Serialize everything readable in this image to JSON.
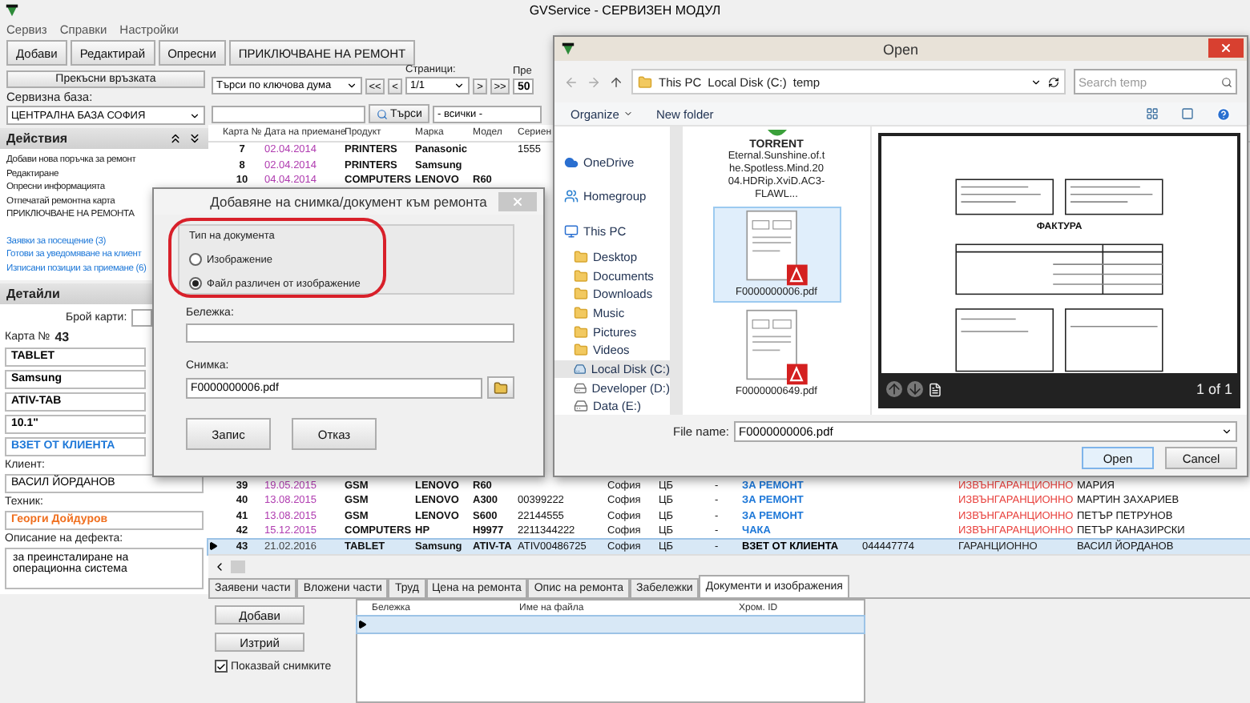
{
  "window": {
    "title": "GVService - СЕРВИЗЕН МОДУЛ"
  },
  "menu": [
    "Сервиз",
    "Справки",
    "Настройки"
  ],
  "toolbar": [
    "Добави",
    "Редактирай",
    "Опресни",
    "ПРИКЛЮЧВАНЕ НА РЕМОНТ"
  ],
  "connection": {
    "disconnect_button": "Прекъсни връзката",
    "base_label": "Сервизна база:",
    "base_value": "ЦЕНТРАЛНА БАЗА СОФИЯ"
  },
  "search": {
    "mode": "Търси по ключова дума",
    "first": "<<",
    "prev": "<",
    "pages_label": "Страници:",
    "page": "1/1",
    "next": ">",
    "last": ">>",
    "per_page_label": "Пре",
    "per_page": "50",
    "search_button": "Търси",
    "filter": "- всички -"
  },
  "actions": {
    "title": "Действия",
    "items": [
      {
        "text": "Добави нова поръчка за ремонт",
        "kind": "command"
      },
      {
        "text": "Редактиране",
        "kind": "command"
      },
      {
        "text": "Опресни информацията",
        "kind": "command"
      },
      {
        "text": "Отпечатай ремонтна карта",
        "kind": "command"
      },
      {
        "text": "ПРИКЛЮЧВАНЕ НА РЕМОНТА",
        "kind": "command"
      },
      {
        "text": "Заявки за посещение (3)",
        "kind": "link"
      },
      {
        "text": "Готови за уведомяване на клиент",
        "kind": "link"
      },
      {
        "text": "Изписани позиции за приемане (6)",
        "kind": "link"
      }
    ]
  },
  "details": {
    "title": "Детайли",
    "count_label": "Брой карти:",
    "card_label": "Карта №",
    "card_no": "43",
    "fields": [
      {
        "text": "TABLET",
        "color": "#000000"
      },
      {
        "text": "Samsung",
        "color": "#000000"
      },
      {
        "text": "ATIV-TAB",
        "color": "#000000"
      },
      {
        "text": "10.1\"",
        "color": "#000000"
      },
      {
        "text": "ВЗЕТ ОТ КЛИЕНТА",
        "color": "#1e78d8"
      }
    ],
    "client_label": "Клиент:",
    "client": "ВАСИЛ ЙОРДАНОВ",
    "tech_label": "Техник:",
    "tech": "Георги Дойдуров",
    "defect_label": "Описание на дефекта:",
    "defect": "за преинсталиране на операционна система"
  },
  "table": {
    "columns": [
      "Карта №",
      "Дата на приемане",
      "Продукт",
      "Марка",
      "Модел",
      "Сериен"
    ],
    "rows": [
      {
        "selected": false,
        "cells": [
          "7",
          {
            "text": "02.04.2014",
            "color": "#b03cb0"
          },
          "PRINTERS",
          "Panasonic",
          null,
          "1555"
        ]
      },
      {
        "selected": false,
        "cells": [
          "8",
          {
            "text": "02.04.2014",
            "color": "#b03cb0"
          },
          "PRINTERS",
          "Samsung",
          null,
          null
        ]
      },
      {
        "selected": false,
        "cells": [
          "10",
          {
            "text": "04.04.2014",
            "color": "#b03cb0"
          },
          "COMPUTERS",
          "LENOVO",
          "R60",
          null
        ]
      },
      {
        "selected": false,
        "cells": [
          "39",
          {
            "text": "19.05.2015",
            "color": "#b03cb0"
          },
          "GSM",
          "LENOVO",
          "R60",
          null,
          "София",
          "ЦБ",
          "-",
          {
            "text": "ЗА РЕМОНТ",
            "color": "#1e78d8"
          },
          null,
          {
            "text": "ИЗВЪНГАРАНЦИОННО",
            "color": "#e8403c"
          },
          "МАРИЯ"
        ]
      },
      {
        "selected": false,
        "cells": [
          "40",
          {
            "text": "13.08.2015",
            "color": "#b03cb0"
          },
          "GSM",
          "LENOVO",
          "A300",
          "00399222",
          "София",
          "ЦБ",
          "-",
          {
            "text": "ЗА РЕМОНТ",
            "color": "#1e78d8"
          },
          null,
          {
            "text": "ИЗВЪНГАРАНЦИОННО",
            "color": "#e8403c"
          },
          "МАРТИН ЗАХАРИЕВ"
        ]
      },
      {
        "selected": false,
        "cells": [
          "41",
          {
            "text": "13.08.2015",
            "color": "#b03cb0"
          },
          "GSM",
          "LENOVO",
          "S600",
          "22144555",
          "София",
          "ЦБ",
          "-",
          {
            "text": "ЗА РЕМОНТ",
            "color": "#1e78d8"
          },
          null,
          {
            "text": "ИЗВЪНГАРАНЦИОННО",
            "color": "#e8403c"
          },
          "ПЕТЪР ПЕТРУНОВ"
        ]
      },
      {
        "selected": false,
        "cells": [
          "42",
          {
            "text": "15.12.2015",
            "color": "#b03cb0"
          },
          "COMPUTERS",
          "HP",
          "H9977",
          "2211344222",
          "София",
          "ЦБ",
          "-",
          {
            "text": "ЧАКА",
            "color": "#1e78d8"
          },
          null,
          {
            "text": "ИЗВЪНГАРАНЦИОННО",
            "color": "#e8403c"
          },
          "ПЕТЪР КАНАЗИРСКИ"
        ]
      },
      {
        "selected": true,
        "cells": [
          "43",
          {
            "text": "21.02.2016",
            "color": "#444444"
          },
          "TABLET",
          "Samsung",
          "ATIV-TA",
          "ATIV00486725",
          "София",
          "ЦБ",
          "-",
          {
            "text": "ВЗЕТ ОТ КЛИЕНТА",
            "color": "#000000"
          },
          "044447774",
          {
            "text": "ГАРАНЦИОННО",
            "color": "#222222"
          },
          "ВАСИЛ ЙОРДАНОВ"
        ]
      }
    ]
  },
  "bottom_tabs": [
    {
      "label": "Заявени части",
      "selected": false
    },
    {
      "label": "Вложени части",
      "selected": false
    },
    {
      "label": "Труд",
      "selected": false
    },
    {
      "label": "Цена на ремонта",
      "selected": false
    },
    {
      "label": "Опис на ремонта",
      "selected": false
    },
    {
      "label": "Забележки",
      "selected": false
    },
    {
      "label": "Документи и изображения",
      "selected": true
    }
  ],
  "documents": {
    "add_button": "Добави",
    "delete_button": "Изтрий",
    "show_images": {
      "label": "Показвай снимките",
      "checked": true
    },
    "columns": [
      "Бележка",
      "Име на файла",
      "Хром. ID"
    ]
  },
  "attach_dialog": {
    "title": "Добавяне на снимка/документ към ремонта",
    "type_group": "Тип на документа",
    "types": [
      {
        "label": "Изображение",
        "selected": false
      },
      {
        "label": "Файл различен от изображение",
        "selected": true
      }
    ],
    "note_label": "Бележка:",
    "image_label": "Снимка:",
    "image_value": "F0000000006.pdf",
    "buttons": [
      "Запис",
      "Отказ"
    ]
  },
  "open_dialog": {
    "title": "Open",
    "path": [
      "This PC",
      "Local Disk (C:)",
      "temp"
    ],
    "search_placeholder": "Search temp",
    "organize": "Organize",
    "new_folder": "New folder",
    "nav": [
      {
        "label": "OneDrive",
        "kind": "cloud",
        "selected": false
      },
      {
        "label": "Homegroup",
        "kind": "group",
        "selected": false
      },
      {
        "label": "This PC",
        "kind": "pc",
        "selected": false,
        "children": [
          {
            "label": "Desktop",
            "kind": "folder",
            "selected": false
          },
          {
            "label": "Documents",
            "kind": "folder",
            "selected": false
          },
          {
            "label": "Downloads",
            "kind": "folder",
            "selected": false
          },
          {
            "label": "Music",
            "kind": "folder",
            "selected": false
          },
          {
            "label": "Pictures",
            "kind": "folder",
            "selected": false
          },
          {
            "label": "Videos",
            "kind": "folder",
            "selected": false
          },
          {
            "label": "Local Disk (C:)",
            "kind": "disk",
            "selected": true
          },
          {
            "label": "Developer (D:)",
            "kind": "drive",
            "selected": false
          },
          {
            "label": "Data (E:)",
            "kind": "drive",
            "selected": false
          }
        ]
      }
    ],
    "files": [
      {
        "kind": "torrent",
        "badge": "TORRENT",
        "name": "Eternal.Sunshine.of.the.Spotless.Mind.2004.HDRip.XviD.AC3-FLAWL...",
        "selected": false
      },
      {
        "kind": "pdf",
        "name": "F0000000006.pdf",
        "selected": true
      },
      {
        "kind": "pdf",
        "name": "F0000000649.pdf",
        "selected": false
      }
    ],
    "preview": {
      "heading": "ФАКТУРА",
      "page": "1 of 1"
    },
    "file_name_label": "File name:",
    "file_name": "F0000000006.pdf",
    "buttons": [
      "Open",
      "Cancel"
    ]
  }
}
